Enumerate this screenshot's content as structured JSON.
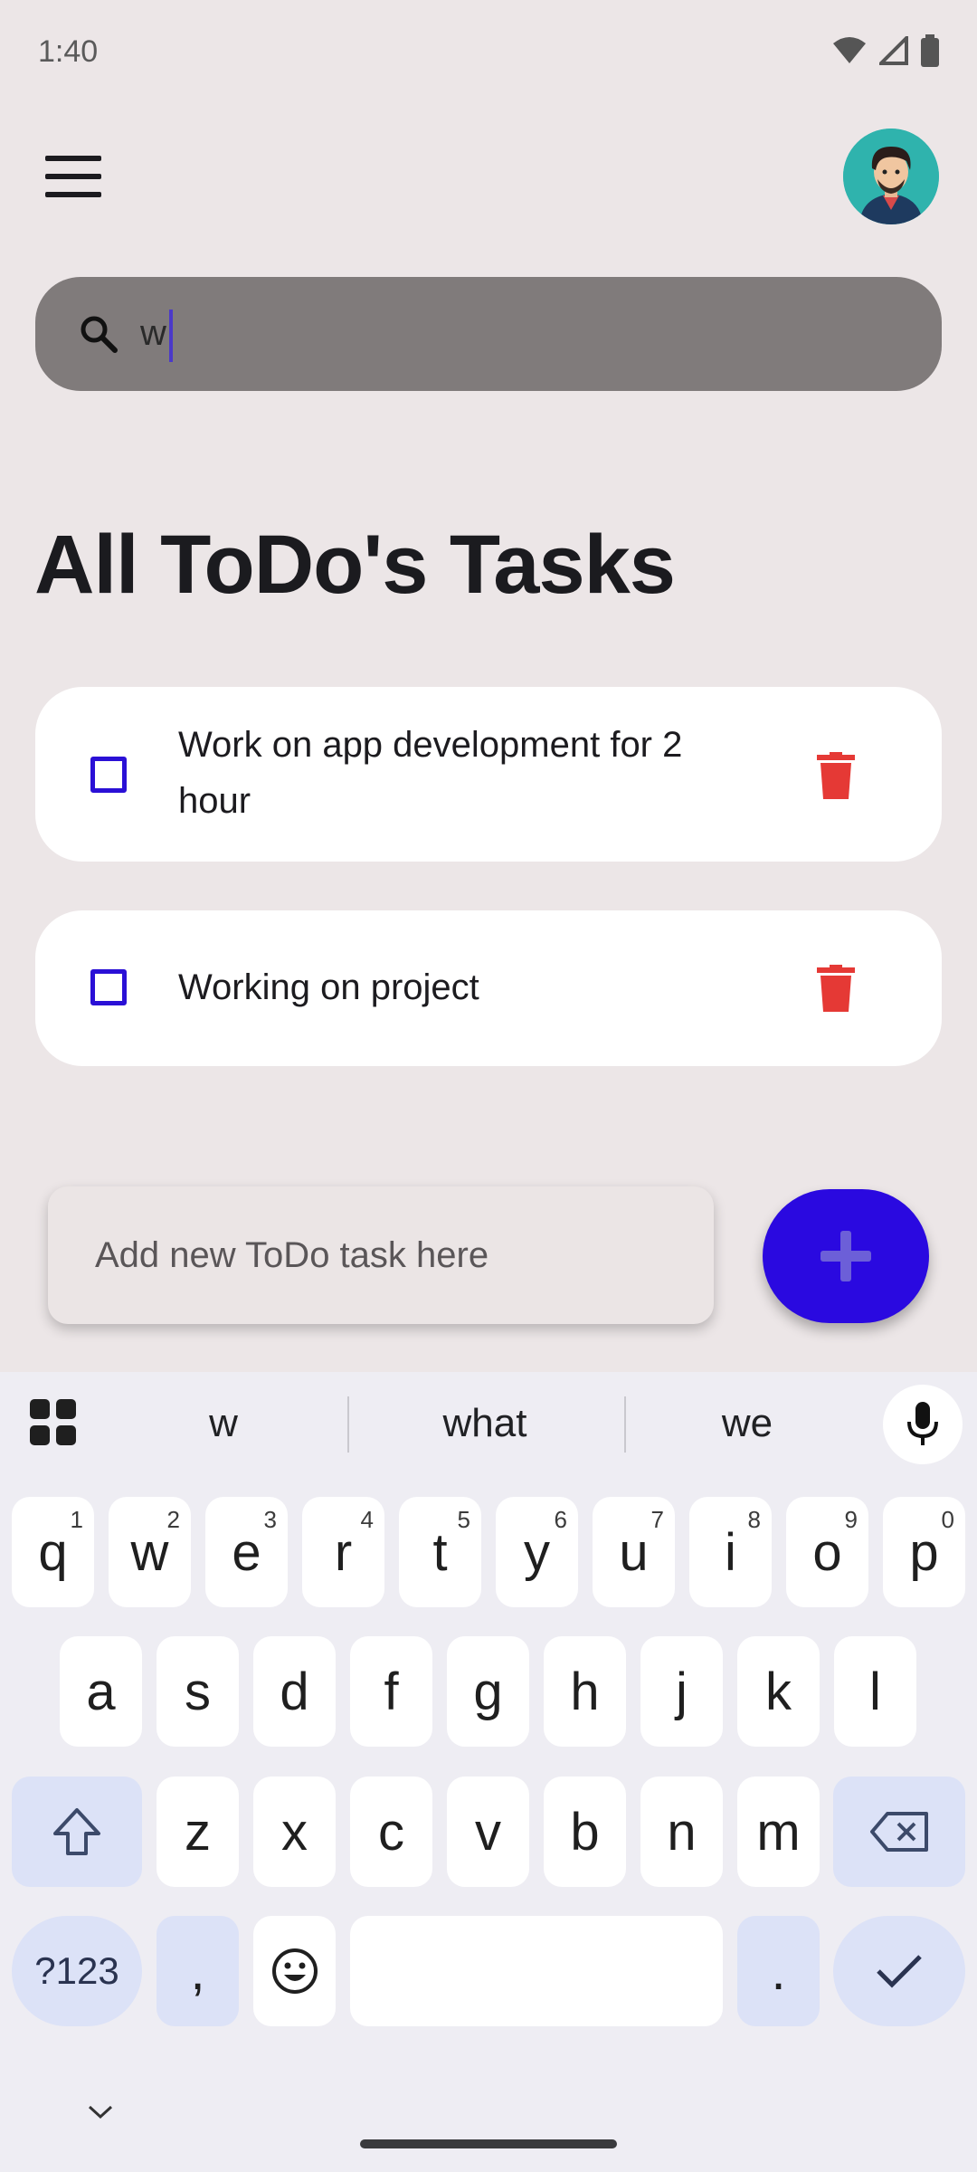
{
  "status": {
    "time": "1:40"
  },
  "search": {
    "value": "w"
  },
  "page": {
    "title": "All ToDo's Tasks"
  },
  "tasks": [
    {
      "line1": "Work on app development for 2",
      "line2": "hour",
      "checked": false
    },
    {
      "line1": "Working on project",
      "checked": false
    }
  ],
  "new_task": {
    "placeholder": "Add new ToDo task here",
    "add_symbol": "+"
  },
  "keyboard": {
    "suggestions": [
      "w",
      "what",
      "we"
    ],
    "row1": [
      {
        "k": "q",
        "h": "1"
      },
      {
        "k": "w",
        "h": "2"
      },
      {
        "k": "e",
        "h": "3"
      },
      {
        "k": "r",
        "h": "4"
      },
      {
        "k": "t",
        "h": "5"
      },
      {
        "k": "y",
        "h": "6"
      },
      {
        "k": "u",
        "h": "7"
      },
      {
        "k": "i",
        "h": "8"
      },
      {
        "k": "o",
        "h": "9"
      },
      {
        "k": "p",
        "h": "0"
      }
    ],
    "row2": [
      "a",
      "s",
      "d",
      "f",
      "g",
      "h",
      "j",
      "k",
      "l"
    ],
    "row3": [
      "z",
      "x",
      "c",
      "v",
      "b",
      "n",
      "m"
    ],
    "symbols_label": "?123",
    "comma": ",",
    "period": "."
  },
  "colors": {
    "accent": "#2A09E0",
    "delete": "#E53935",
    "background": "#ECE6E7",
    "search_bg": "#807B7B"
  },
  "icons": [
    "menu-icon",
    "avatar",
    "search-icon",
    "trash-icon",
    "plus-icon",
    "apps-grid-icon",
    "mic-icon",
    "shift-icon",
    "backspace-icon",
    "emoji-icon",
    "check-icon",
    "chevron-down-icon"
  ]
}
